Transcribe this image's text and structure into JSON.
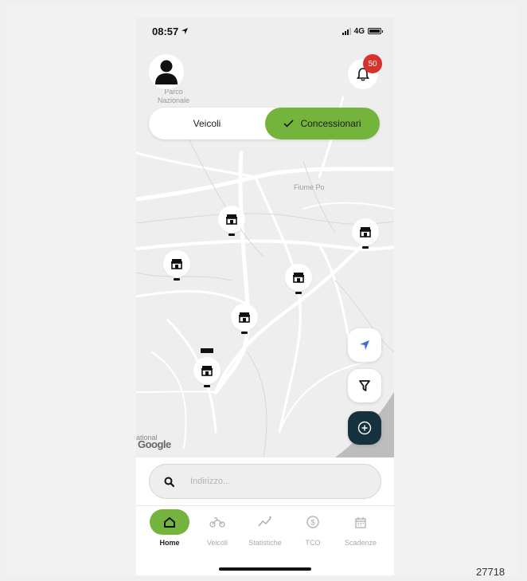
{
  "status_bar": {
    "time": "08:57",
    "network": "4G"
  },
  "map": {
    "labels": {
      "parco": "Parco\nNazionale",
      "fiume": "Fiume Po",
      "edge": "ational",
      "google": "Google"
    }
  },
  "notifications": {
    "count": "50"
  },
  "segmented": {
    "left_label": "Veicoli",
    "right_label": "Concessionari",
    "active": "Concessionari"
  },
  "search": {
    "placeholder": "Indirizzo..."
  },
  "tabs": [
    {
      "label": "Home",
      "icon": "home-icon",
      "active": true
    },
    {
      "label": "Veicoli",
      "icon": "motorbike-icon",
      "active": false
    },
    {
      "label": "Statistiche",
      "icon": "stats-icon",
      "active": false
    },
    {
      "label": "TCO",
      "icon": "dollar-icon",
      "active": false
    },
    {
      "label": "Scadenze",
      "icon": "calendar-icon",
      "active": false
    }
  ],
  "map_buttons": [
    "location-arrow-icon",
    "filter-icon",
    "add-icon"
  ],
  "watermark": "27718",
  "colors": {
    "accent": "#74b43c",
    "badge": "#d9312b",
    "fab_dark": "#16323f"
  }
}
